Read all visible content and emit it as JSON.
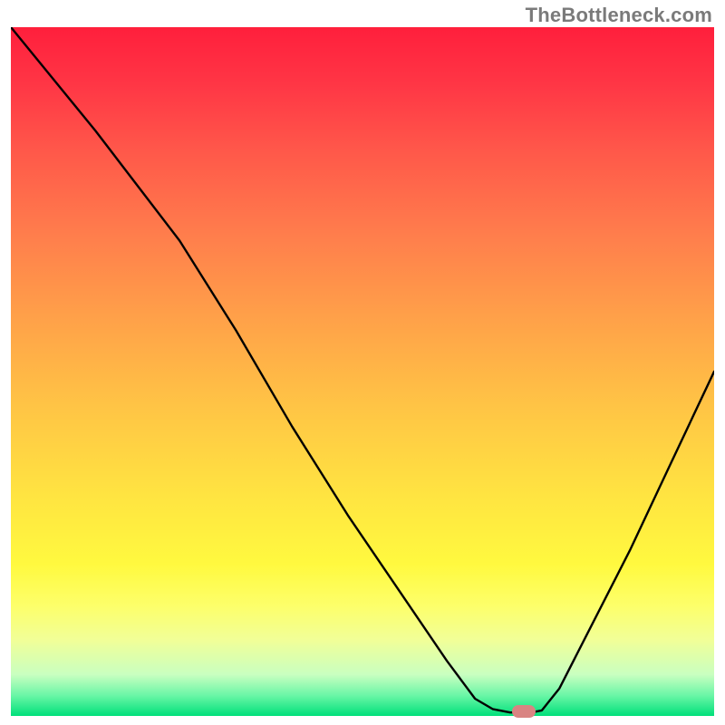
{
  "watermark": {
    "text": "TheBottleneck.com"
  },
  "marker": {
    "color": "#d98482"
  },
  "chart_data": {
    "type": "line",
    "title": "",
    "xlabel": "",
    "ylabel": "",
    "xlim": [
      0,
      100
    ],
    "ylim": [
      0,
      100
    ],
    "grid": false,
    "legend": false,
    "series": [
      {
        "name": "curve",
        "x": [
          0,
          12,
          24,
          32,
          40,
          48,
          56,
          62,
          66,
          68.5,
          71,
          74,
          75.5,
          78,
          82,
          88,
          94,
          100
        ],
        "y": [
          100,
          85,
          69,
          56,
          42,
          29,
          17,
          8,
          2.5,
          1,
          0.5,
          0.5,
          0.8,
          4,
          12,
          24,
          37,
          50
        ]
      }
    ],
    "marker_point": {
      "x": 73,
      "y": 0.6
    },
    "background": {
      "type": "vertical-gradient",
      "stops": [
        {
          "pos": 0,
          "color": "#ff1f3c"
        },
        {
          "pos": 50,
          "color": "#ffc445"
        },
        {
          "pos": 80,
          "color": "#fff93f"
        },
        {
          "pos": 100,
          "color": "#00e07a"
        }
      ]
    }
  }
}
